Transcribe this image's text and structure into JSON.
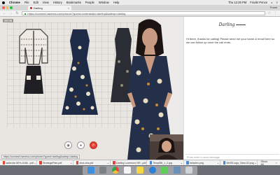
{
  "menubar": {
    "app": "Chrome",
    "items": [
      "File",
      "Edit",
      "View",
      "History",
      "Bookmarks",
      "People",
      "Window",
      "Help"
    ],
    "clock": "Thu 12:26 PM",
    "user": "Frank! Pence"
  },
  "tab": {
    "title": "Darling",
    "close": "×"
  },
  "profile_label": "Frank",
  "toolbar": {
    "back": "←",
    "forward": "→",
    "reload": "↻",
    "url": "https://connect.hamrica.com/phone/?guest=xxxbrandid=darling&salesp=darling",
    "star": "☆"
  },
  "video": {
    "timer": "00:06",
    "status_url": "https://connect.hamrica.com/phone/?guest=darling&salesp=darling",
    "controls": [
      {
        "name": "camera",
        "glyph": "◉"
      },
      {
        "name": "microphone",
        "glyph": "●"
      },
      {
        "name": "end-call",
        "glyph": "✆"
      }
    ]
  },
  "chat": {
    "logo": "Darling",
    "message": "Hi there, thanks for calling! Please send me your name & email here so we can follow up once the call ends.",
    "input_placeholder": "Press enter to send message"
  },
  "downloads": [
    "ladbroke 80%-4186...pdf",
    "StrategicPlan.pdf",
    "shot-ohs.pdf",
    "Darling Luxemore NR...pdf",
    "TempBill_1_2.jpg",
    "heladen.png",
    "BHSE-logo_New-02.png"
  ],
  "show_all": "Show All",
  "close_shelf": "×",
  "dock": {
    "icons": [
      "finder-icon",
      "launchpad-icon",
      "chrome-icon",
      "photos-icon",
      "notes-icon",
      "safari-icon",
      "messages-icon",
      "preview-icon",
      "trash-icon"
    ],
    "colors": [
      "#3d8fe0",
      "#7b7f86",
      "#e8453c",
      "#f4f4f4",
      "#f5d646",
      "#2c7ed6",
      "#5fcf5a",
      "#6a8fb8",
      "#cfd3d8"
    ]
  },
  "colors": {
    "end_call": "#e23b2e",
    "traffic_red": "#fc5f57",
    "traffic_yellow": "#fdbc2e",
    "traffic_green": "#28c840"
  }
}
